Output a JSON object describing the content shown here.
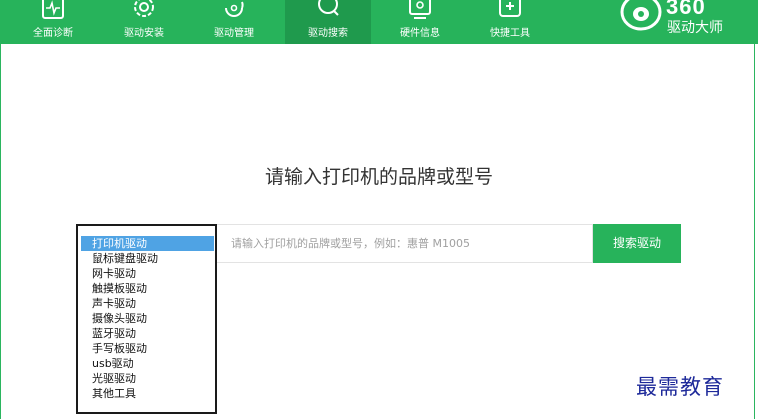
{
  "nav": {
    "items": [
      {
        "label": "全面诊断",
        "icon": "monitor-pulse-icon"
      },
      {
        "label": "驱动安装",
        "icon": "gear-icon"
      },
      {
        "label": "驱动管理",
        "icon": "refresh-icon"
      },
      {
        "label": "驱动搜索",
        "icon": "search-icon",
        "active": true
      },
      {
        "label": "硬件信息",
        "icon": "monitor-user-icon"
      },
      {
        "label": "快捷工具",
        "icon": "toolbox-icon"
      }
    ],
    "active_color": "#1f9a4d",
    "bar_color": "#27b35b"
  },
  "brand": {
    "name_top": "360",
    "name_bottom": "驱动大师",
    "logo_icon": "360-shield-logo-icon"
  },
  "search": {
    "headline": "请输入打印机的品牌或型号",
    "placeholder": "请输入打印机的品牌或型号，例如：惠普 M1005",
    "button_label": "搜索驱动",
    "category_options": [
      "打印机驱动",
      "鼠标键盘驱动",
      "网卡驱动",
      "触摸板驱动",
      "声卡驱动",
      "摄像头驱动",
      "蓝牙驱动",
      "手写板驱动",
      "usb驱动",
      "光驱驱动",
      "其他工具"
    ],
    "selected_option": "打印机驱动"
  },
  "watermark": "最需教育"
}
